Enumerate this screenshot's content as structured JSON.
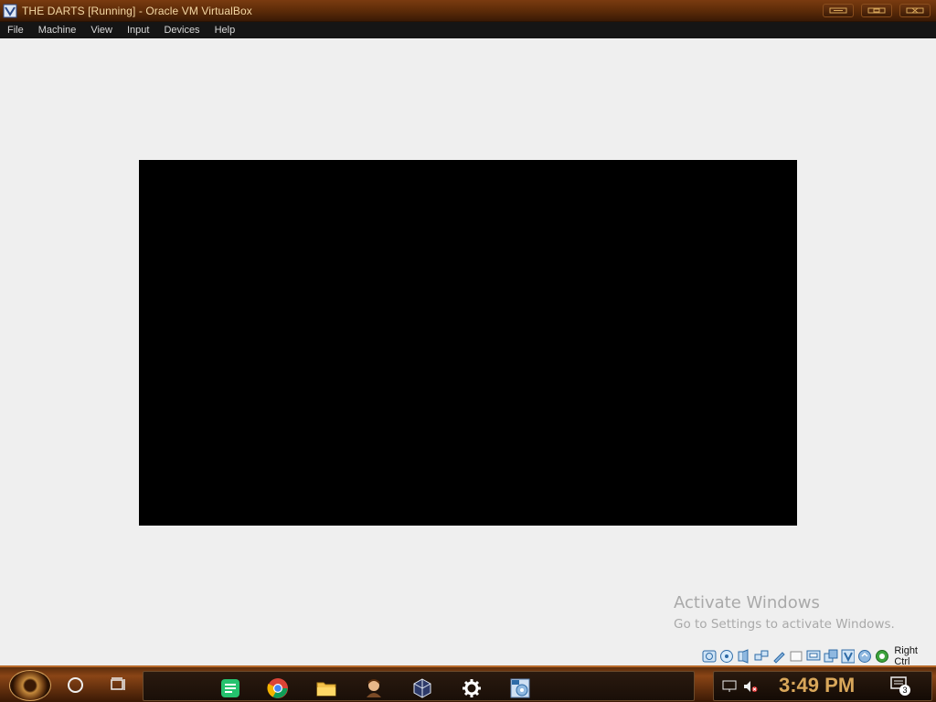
{
  "window": {
    "title": "THE DARTS [Running] - Oracle VM VirtualBox",
    "controls": [
      "minimize",
      "maximize",
      "close"
    ]
  },
  "menu": {
    "items": [
      "File",
      "Machine",
      "View",
      "Input",
      "Devices",
      "Help"
    ]
  },
  "watermark": {
    "line1": "Activate Windows",
    "line2": "Go to Settings to activate Windows."
  },
  "vbox_status": {
    "icons": [
      "hard-disk-icon",
      "optical-drive-icon",
      "audio-icon",
      "network-icon",
      "usb-icon",
      "shared-folders-icon",
      "display-icon",
      "video-capture-icon",
      "mouse-integration-icon",
      "cpu-icon",
      "keyboard-icon"
    ],
    "host_key": "Right Ctrl"
  },
  "taskbar": {
    "apps": [
      "notes-app-icon",
      "chrome-icon",
      "file-explorer-icon",
      "game-app-icon",
      "virtualbox-icon",
      "settings-icon",
      "disc-app-icon"
    ],
    "clock": "3:49 PM",
    "notification_count": "3"
  },
  "colors": {
    "titlebar": "#5a2a08",
    "title_text": "#f3d7a4",
    "clock_text": "#d9a75a",
    "vm_background": "#efefef"
  }
}
